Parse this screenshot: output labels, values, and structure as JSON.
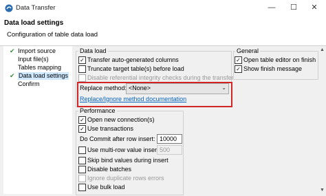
{
  "window": {
    "title": "Data Transfer",
    "minimize_icon": "minimize-icon",
    "maximize_icon": "maximize-icon",
    "close_icon": "close-icon"
  },
  "header": {
    "title": "Data load settings",
    "subtitle": "Configuration of table data load"
  },
  "nav": {
    "items": [
      {
        "label": "Import source",
        "checked": true,
        "selected": false
      },
      {
        "label": "Input file(s)",
        "checked": false,
        "selected": false
      },
      {
        "label": "Tables mapping",
        "checked": false,
        "selected": false
      },
      {
        "label": "Data load settings",
        "checked": true,
        "selected": true
      },
      {
        "label": "Confirm",
        "checked": false,
        "selected": false
      }
    ]
  },
  "data_load": {
    "title": "Data load",
    "transfer_auto": "Transfer auto-generated columns",
    "truncate": "Truncate target table(s) before load",
    "disable_ref": "Disable referential integrity checks during the transfer",
    "replace_label": "Replace method:",
    "replace_value": "<None>",
    "replace_link": "Replace/Ignore method documentation"
  },
  "general": {
    "title": "General",
    "open_editor": "Open table editor on finish",
    "show_finish": "Show finish message"
  },
  "performance": {
    "title": "Performance",
    "open_new_conn": "Open new connection(s)",
    "use_transactions": "Use transactions",
    "commit_label": "Do Commit after row insert:",
    "commit_value": "10000",
    "multi_row": "Use multi-row value insert",
    "multi_row_value": "500",
    "skip_bind": "Skip bind values during insert",
    "disable_batches": "Disable batches",
    "ignore_dup": "Ignore duplicate rows errors",
    "bulk_load": "Use bulk load"
  }
}
